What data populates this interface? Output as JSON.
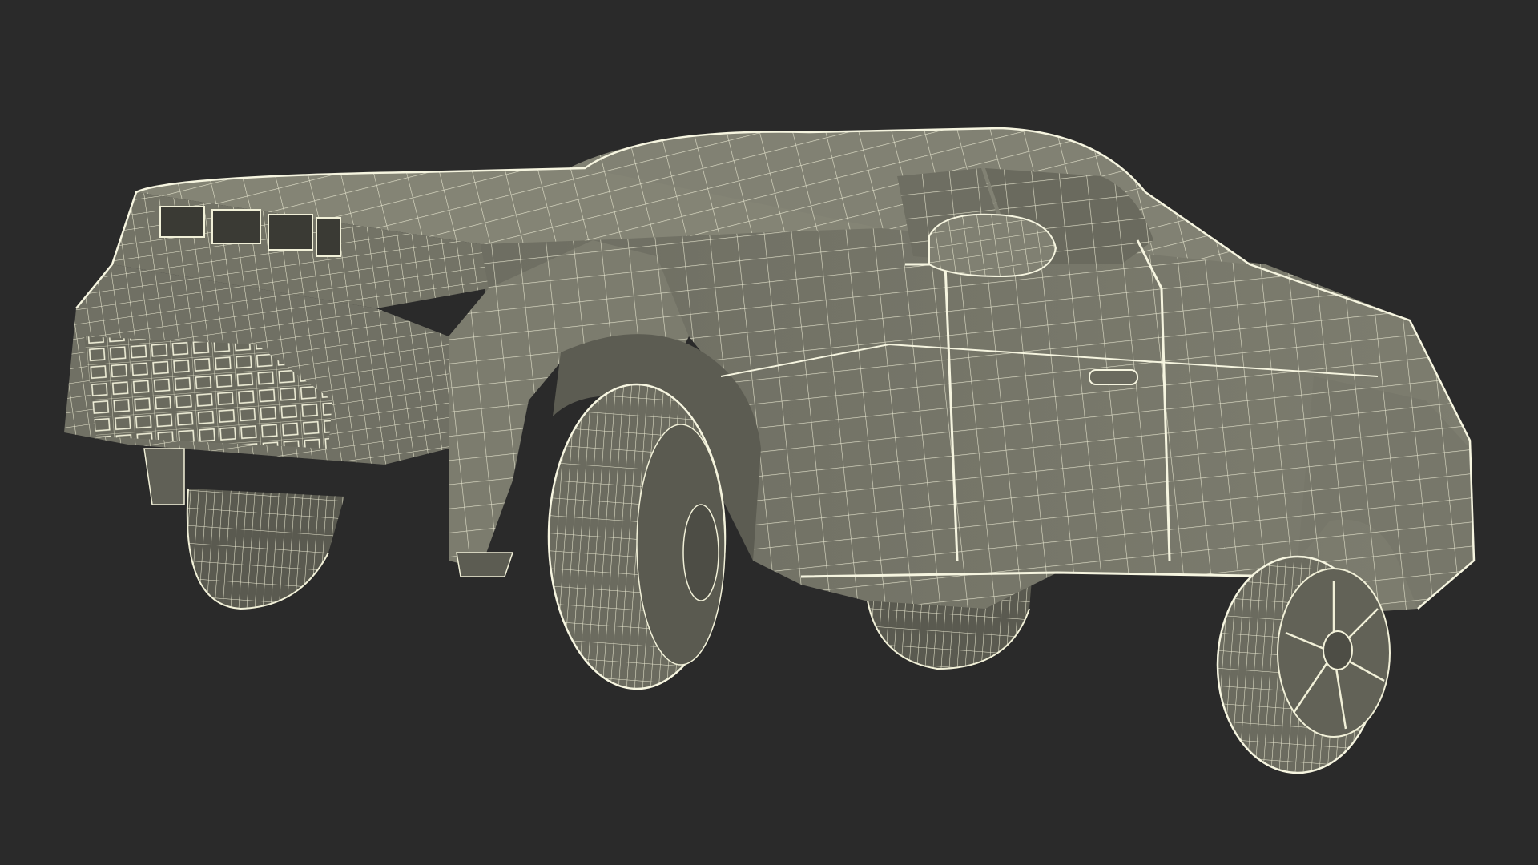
{
  "scene": {
    "subject": "wireframe-pickup-truck",
    "colors": {
      "background": "#2a2a2a",
      "body": "#7d7d6f",
      "body_dark": "#5f5f55",
      "body_shadow": "#4d4d45",
      "wire": "#f1f0d8",
      "wire_dim": "#d9d8bf"
    }
  }
}
